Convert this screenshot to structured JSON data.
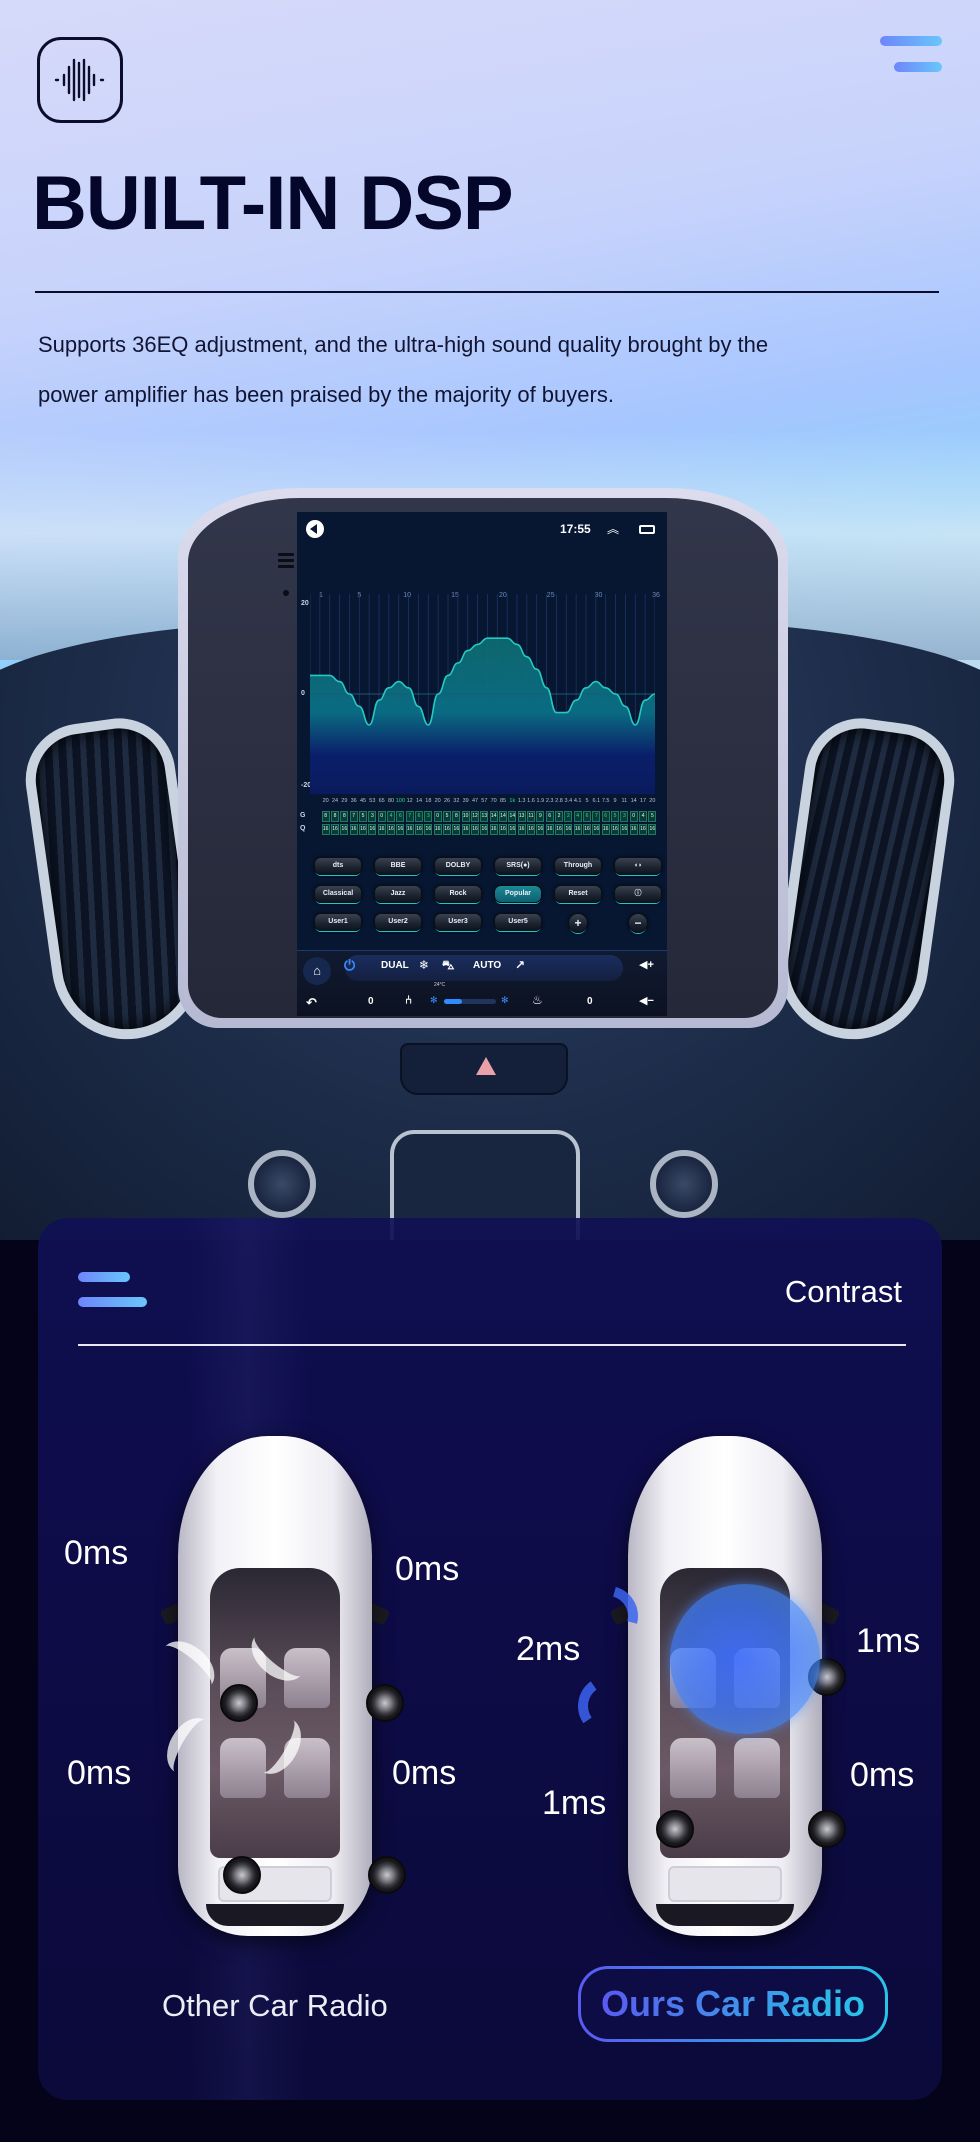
{
  "header": {
    "logo_icon": "sound-wave-icon",
    "menu_icon": "menu-icon",
    "title": "BUILT-IN DSP",
    "description_line1": "Supports 36EQ adjustment, and the ultra-high sound quality brought by the",
    "description_line2": "power amplifier has been praised by the majority of buyers."
  },
  "head_unit": {
    "status_bar": {
      "back_icon": "back-circle-icon",
      "time": "17:55",
      "up_icon": "double-chevron-up-icon",
      "recents_icon": "recents-icon"
    },
    "eq": {
      "band_markers": [
        "1",
        "5",
        "10",
        "15",
        "20",
        "25",
        "30",
        "36"
      ],
      "y_labels": {
        "top": "20",
        "mid": "0",
        "bottom": "-20"
      },
      "frequencies": [
        "20",
        "24",
        "29",
        "36",
        "45",
        "53",
        "65",
        "80",
        "100",
        "12",
        "14",
        "18",
        "20",
        "26",
        "32",
        "39",
        "47",
        "57",
        "70",
        "85",
        "1k",
        "1.3",
        "1.6",
        "1.9",
        "2.3",
        "2.8",
        "3.4",
        "4.1",
        "5",
        "6.1",
        "7.5",
        "9",
        "11",
        "14",
        "17",
        "20"
      ],
      "highlight_frequencies": [
        8,
        20
      ],
      "gain_label": "G",
      "q_label": "Q",
      "gains": [
        "8",
        "8",
        "8",
        "7",
        "5",
        "3",
        "0",
        "4",
        "6",
        "7",
        "6",
        "3",
        "0",
        "5",
        "8",
        "10",
        "12",
        "13",
        "14",
        "14",
        "14",
        "13",
        "11",
        "9",
        "6",
        "2",
        "2",
        "4",
        "6",
        "7",
        "6",
        "5",
        "3",
        "0",
        "4",
        "5"
      ],
      "gain_highlight_range": [
        7,
        11,
        26,
        32
      ],
      "q_values": [
        "16",
        "16",
        "16",
        "16",
        "16",
        "16",
        "16",
        "16",
        "16",
        "16",
        "16",
        "16",
        "16",
        "16",
        "16",
        "16",
        "16",
        "16",
        "16",
        "16",
        "16",
        "16",
        "16",
        "16",
        "16",
        "16",
        "16",
        "16",
        "16",
        "16",
        "16",
        "16",
        "16",
        "16",
        "16",
        "16"
      ]
    },
    "buttons_row1": [
      "dts",
      "BBE",
      "DOLBY",
      "SRS(●)",
      "Through",
      "◖◗"
    ],
    "buttons_row2": [
      "Classical",
      "Jazz",
      "Rock",
      "Popular",
      "Reset",
      "ⓘ"
    ],
    "buttons_row3": [
      "User1",
      "User2",
      "User3",
      "User5",
      "+",
      "−"
    ],
    "active_preset": "Popular",
    "climate": {
      "home_icon": "home-icon",
      "power_icon": "power-icon",
      "dual": "DUAL",
      "snowflake_icon": "snowflake-icon",
      "recirc_icon": "car-recirculation-icon",
      "auto": "AUTO",
      "airflow_icon": "seat-airflow-icon",
      "vol_up": "◀+",
      "vol_down": "◀−",
      "back_icon": "back-arrow-icon",
      "left_seat_value": "0",
      "seat_icon": "seat-icon",
      "temperature": "24°C",
      "fan_level": 0.35,
      "heated_seat_icon": "heated-seat-icon",
      "right_seat_value": "0"
    }
  },
  "contrast": {
    "menu_icon": "menu-icon",
    "title": "Contrast",
    "other": {
      "label": "Other Car Radio",
      "front_left": "0ms",
      "front_right": "0ms",
      "rear_left": "0ms",
      "rear_right": "0ms"
    },
    "ours": {
      "label": "Ours Car Radio",
      "front_left": "2ms",
      "front_right": "1ms",
      "rear_left": "1ms",
      "rear_right": "0ms"
    },
    "accent_gradient": [
      "#5a5af0",
      "#28c4e6"
    ]
  }
}
